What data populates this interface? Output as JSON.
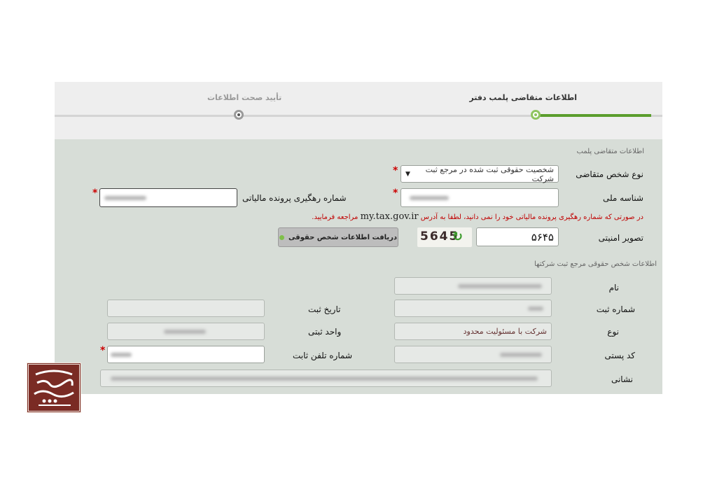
{
  "stepper": {
    "steps": [
      {
        "label": "اطلاعات متقاضی پلمب دفتر",
        "state": "active"
      },
      {
        "label": "تأیید صحت اطلاعات",
        "state": "pending"
      }
    ],
    "active_color": "#5b9e2d"
  },
  "applicant_section": {
    "title": "اطلاعات متقاضی پلمب",
    "person_type": {
      "label": "نوع شخص متقاضی",
      "value": "شخصیت حقوقی ثبت شده در مرجع ثبت شرکت"
    },
    "national_id": {
      "label": "شناسه ملی"
    },
    "tax_tracking": {
      "label": "شماره رهگیری پرونده مالیاتی"
    },
    "hint": {
      "text_before": "در صورتی که شماره رهگیری پرونده مالیاتی خود را نمی دانید، لطفا به آدرس",
      "url": "my.tax.gov.ir",
      "text_after": "مراجعه فرمایید."
    },
    "security_image": {
      "label": "تصویر امنیتی",
      "value": "۵۶۴۵",
      "captcha_text": "5645"
    },
    "fetch_button": {
      "label": "دریافت اطلاعات شخص حقوقی"
    },
    "required_mark": "*"
  },
  "company_section": {
    "title": "اطلاعات شخص حقوقی مرجع ثبت شرکتها",
    "name": {
      "label": "نام"
    },
    "reg_number": {
      "label": "شماره ثبت"
    },
    "reg_date": {
      "label": "تاریخ ثبت"
    },
    "type": {
      "label": "نوع",
      "value": "شرکت با مسئولیت محدود"
    },
    "reg_unit": {
      "label": "واحد ثبتی"
    },
    "postal_code": {
      "label": "کد پستی"
    },
    "landline": {
      "label": "شماره تلفن ثابت"
    },
    "address": {
      "label": "نشانی"
    }
  },
  "logo": {
    "brand_color": "#7a2b24"
  },
  "colors": {
    "panel": "#d7ddd7",
    "required": "#cc0000",
    "hint": "#c00000"
  }
}
